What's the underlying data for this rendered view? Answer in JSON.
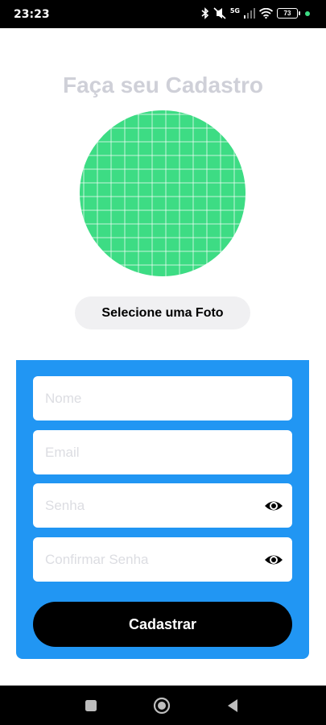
{
  "status_bar": {
    "time": "23:23",
    "network_label": "5G",
    "battery_level": "73",
    "icons": [
      "bluetooth-icon",
      "silent-icon",
      "signal-icon",
      "wifi-icon",
      "battery-icon",
      "notification-dot-icon"
    ]
  },
  "screen": {
    "title": "Faça seu Cadastro",
    "select_photo_label": "Selecione uma Foto"
  },
  "form": {
    "name_placeholder": "Nome",
    "email_placeholder": "Email",
    "password_placeholder": "Senha",
    "confirm_password_placeholder": "Confirmar Senha",
    "submit_label": "Cadastrar"
  },
  "nav_bar": {
    "buttons": [
      "recents-square-icon",
      "home-circle-icon",
      "back-triangle-icon"
    ]
  },
  "colors": {
    "status_bar": "#000000",
    "title": "#cfd0d8",
    "photo_placeholder": "#3ddc84",
    "select_photo_bg": "#f0f0f2",
    "form_panel": "#2196f3",
    "submit_button": "#000000",
    "nav_bar": "#000000"
  }
}
